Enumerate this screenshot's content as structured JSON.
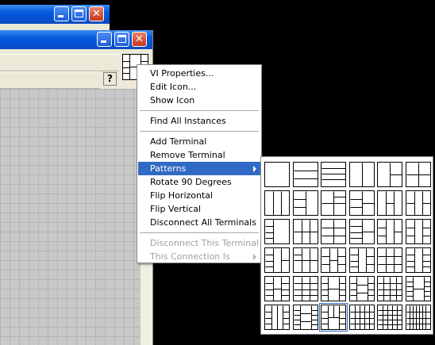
{
  "windows": {
    "back": {
      "minimize": "minimize",
      "maximize": "maximize",
      "close": "close"
    },
    "front": {
      "minimize": "minimize",
      "maximize": "maximize",
      "close": "close",
      "help_icon": "?"
    }
  },
  "context_menu": {
    "groups": [
      [
        {
          "label": "VI Properties...",
          "state": "normal"
        },
        {
          "label": "Edit Icon...",
          "state": "normal"
        },
        {
          "label": "Show Icon",
          "state": "normal"
        }
      ],
      [
        {
          "label": "Find All Instances",
          "state": "normal"
        }
      ],
      [
        {
          "label": "Add Terminal",
          "state": "normal"
        },
        {
          "label": "Remove Terminal",
          "state": "normal"
        },
        {
          "label": "Patterns",
          "state": "highlighted",
          "submenu": true
        },
        {
          "label": "Rotate 90 Degrees",
          "state": "normal"
        },
        {
          "label": "Flip Horizontal",
          "state": "normal"
        },
        {
          "label": "Flip Vertical",
          "state": "normal"
        },
        {
          "label": "Disconnect All Terminals",
          "state": "normal"
        }
      ],
      [
        {
          "label": "Disconnect This Terminal",
          "state": "disabled"
        },
        {
          "label": "This Connection Is",
          "state": "disabled",
          "submenu": true
        }
      ]
    ]
  },
  "patterns_submenu": {
    "rows": 6,
    "columns": 6,
    "selected_index": 32
  },
  "colors": {
    "menu_highlight": "#316ac5",
    "disabled_text": "#a0a0a0",
    "desktop": "#000000",
    "window_face": "#ece9d8"
  }
}
